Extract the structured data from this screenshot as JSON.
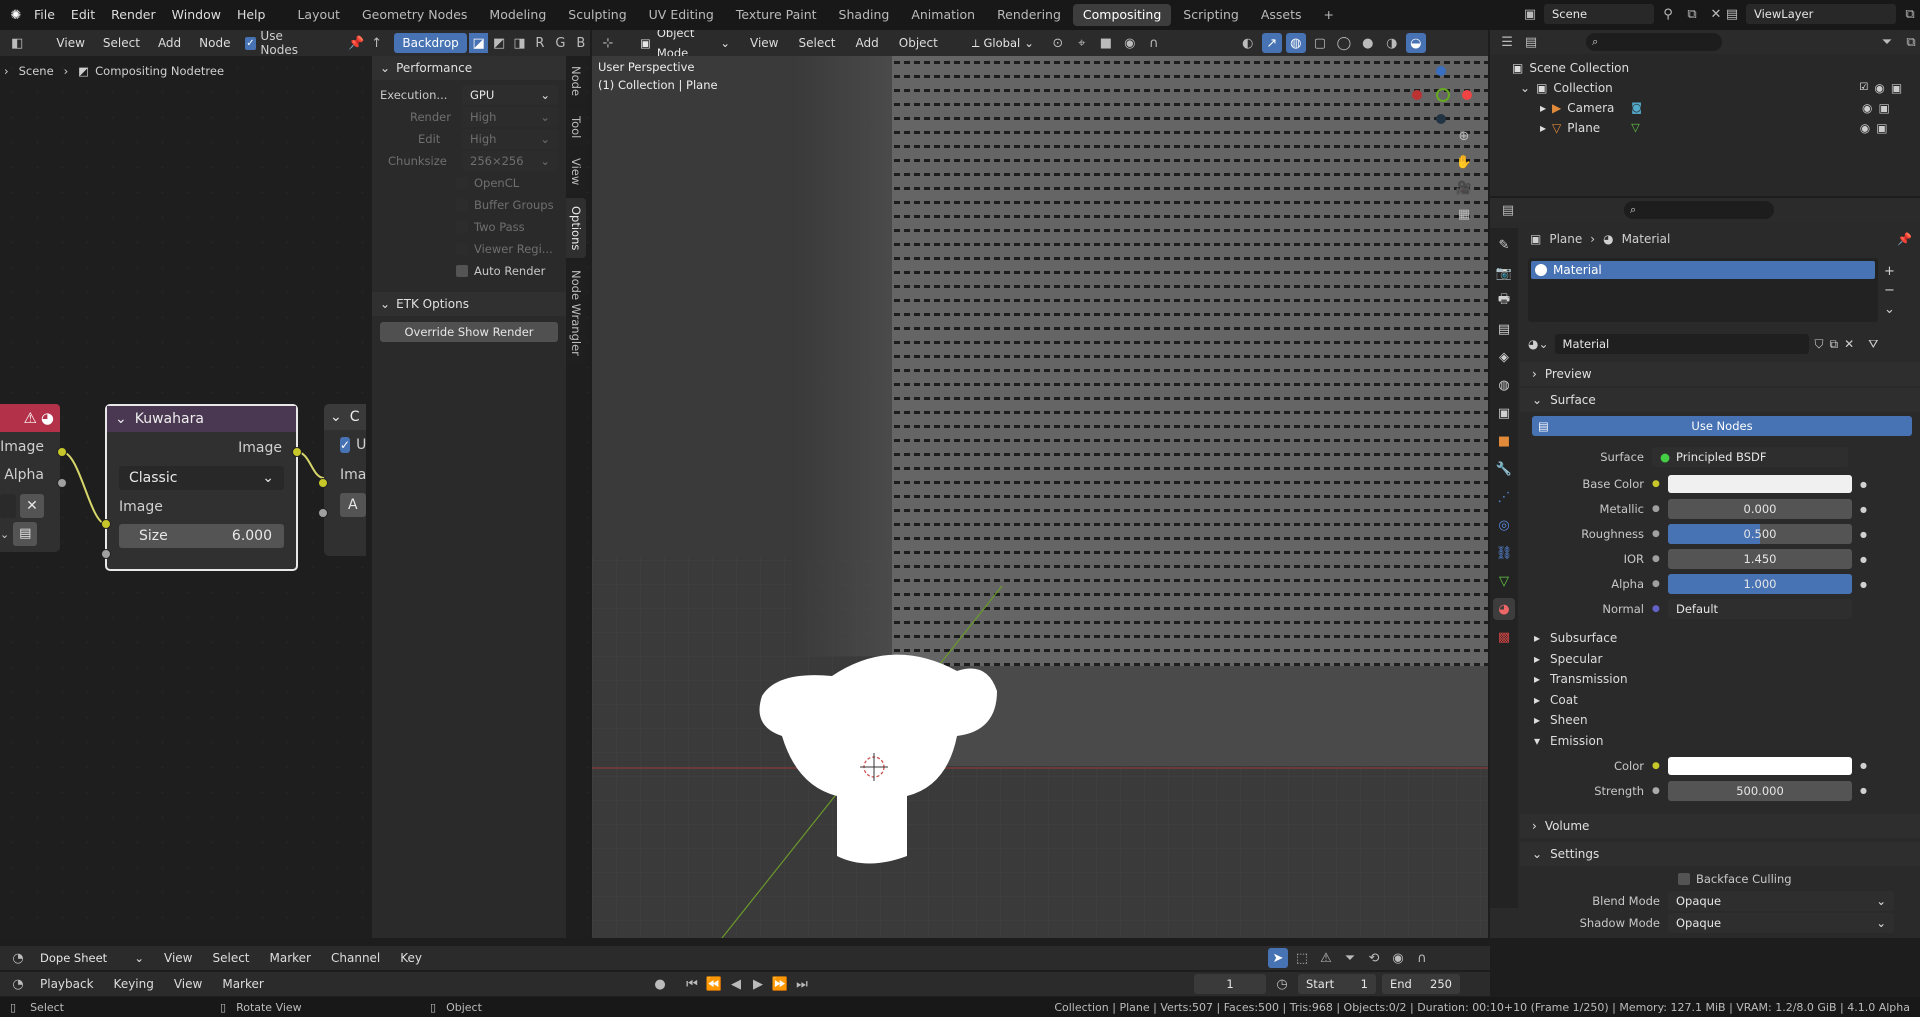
{
  "topbar": {
    "menus": [
      "File",
      "Edit",
      "Render",
      "Window",
      "Help"
    ],
    "workspaces": [
      "Layout",
      "Geometry Nodes",
      "Modeling",
      "Sculpting",
      "UV Editing",
      "Texture Paint",
      "Shading",
      "Animation",
      "Rendering",
      "Compositing",
      "Scripting",
      "Assets"
    ],
    "active_workspace": "Compositing",
    "add": "+",
    "scene": "Scene",
    "viewlayer": "ViewLayer"
  },
  "node_editor": {
    "menus": [
      "View",
      "Select",
      "Add",
      "Node"
    ],
    "use_nodes": "Use Nodes",
    "backdrop": "Backdrop",
    "breadcrumb": {
      "scene": "Scene",
      "tree": "Compositing Nodetree"
    },
    "nodes": {
      "left": {
        "image": "Image",
        "alpha": "Alpha"
      },
      "kuwahara": {
        "title": "Kuwahara",
        "out_image": "Image",
        "mode": "Classic",
        "in_image": "Image",
        "size_label": "Size",
        "size_value": "6.000"
      },
      "right": {
        "title": "C",
        "check": "U",
        "image": "Ima",
        "field": "A"
      }
    }
  },
  "sidebar": {
    "performance": {
      "title": "Performance",
      "execution_label": "Execution...",
      "execution_value": "GPU",
      "render_label": "Render",
      "render_value": "High",
      "edit_label": "Edit",
      "edit_value": "High",
      "chunk_label": "Chunksize",
      "chunk_value": "256×256",
      "checks": [
        "OpenCL",
        "Buffer Groups",
        "Two Pass",
        "Viewer Regi..."
      ],
      "auto_render": "Auto Render"
    },
    "etk": {
      "title": "ETK Options",
      "button": "Override Show Render"
    },
    "tabs": [
      "Node",
      "Tool",
      "View",
      "Options",
      "Node Wrangler"
    ],
    "active_tab": "Options"
  },
  "viewport": {
    "mode": "Object Mode",
    "menus": [
      "View",
      "Select",
      "Add",
      "Object"
    ],
    "transform": "Global",
    "perspective": "User Perspective",
    "collection": "(1) Collection | Plane"
  },
  "outliner": {
    "root": "Scene Collection",
    "collection": "Collection",
    "items": [
      "Camera",
      "Plane"
    ]
  },
  "properties": {
    "breadcrumb": {
      "obj": "Plane",
      "mat": "Material"
    },
    "slot": "Material",
    "material_name": "Material",
    "preview": "Preview",
    "surface_panel": "Surface",
    "use_nodes": "Use Nodes",
    "surface": {
      "label": "Surface",
      "value": "Principled BSDF"
    },
    "fields": [
      {
        "label": "Base Color",
        "value": "",
        "type": "color"
      },
      {
        "label": "Metallic",
        "value": "0.000",
        "type": "num"
      },
      {
        "label": "Roughness",
        "value": "0.500",
        "type": "bar",
        "fill": 0.5
      },
      {
        "label": "IOR",
        "value": "1.450",
        "type": "num"
      },
      {
        "label": "Alpha",
        "value": "1.000",
        "type": "bar",
        "fill": 1.0
      },
      {
        "label": "Normal",
        "value": "Default",
        "type": "link"
      }
    ],
    "subpanels": [
      "Subsurface",
      "Specular",
      "Transmission",
      "Coat",
      "Sheen"
    ],
    "emission": {
      "title": "Emission",
      "color_label": "Color",
      "strength_label": "Strength",
      "strength_value": "500.000"
    },
    "volume": "Volume",
    "settings": "Settings",
    "backface": "Backface Culling",
    "blend_label": "Blend Mode",
    "blend_value": "Opaque",
    "shadow_label": "Shadow Mode",
    "shadow_value": "Opaque"
  },
  "timeline": {
    "editor": "Dope Sheet",
    "menus": [
      "View",
      "Select",
      "Marker",
      "Channel",
      "Key"
    ],
    "menus2": [
      "Playback",
      "Keying",
      "View",
      "Marker"
    ],
    "frame": "1",
    "start_label": "Start",
    "start": "1",
    "end_label": "End",
    "end": "250"
  },
  "status": {
    "select": "Select",
    "rotate": "Rotate View",
    "object": "Object",
    "info": "Collection | Plane | Verts:507 | Faces:500 | Tris:968 | Objects:0/2 | Duration: 00:10+10 (Frame 1/250) | Memory: 127.1 MiB | VRAM: 1.2/8.0 GiB | 4.1.0 Alpha"
  },
  "colors": {
    "accent": "#4772b3",
    "node_header_kuwahara": "#4a3751",
    "socket_yellow": "#c7c729",
    "error_red": "#b3324a"
  }
}
